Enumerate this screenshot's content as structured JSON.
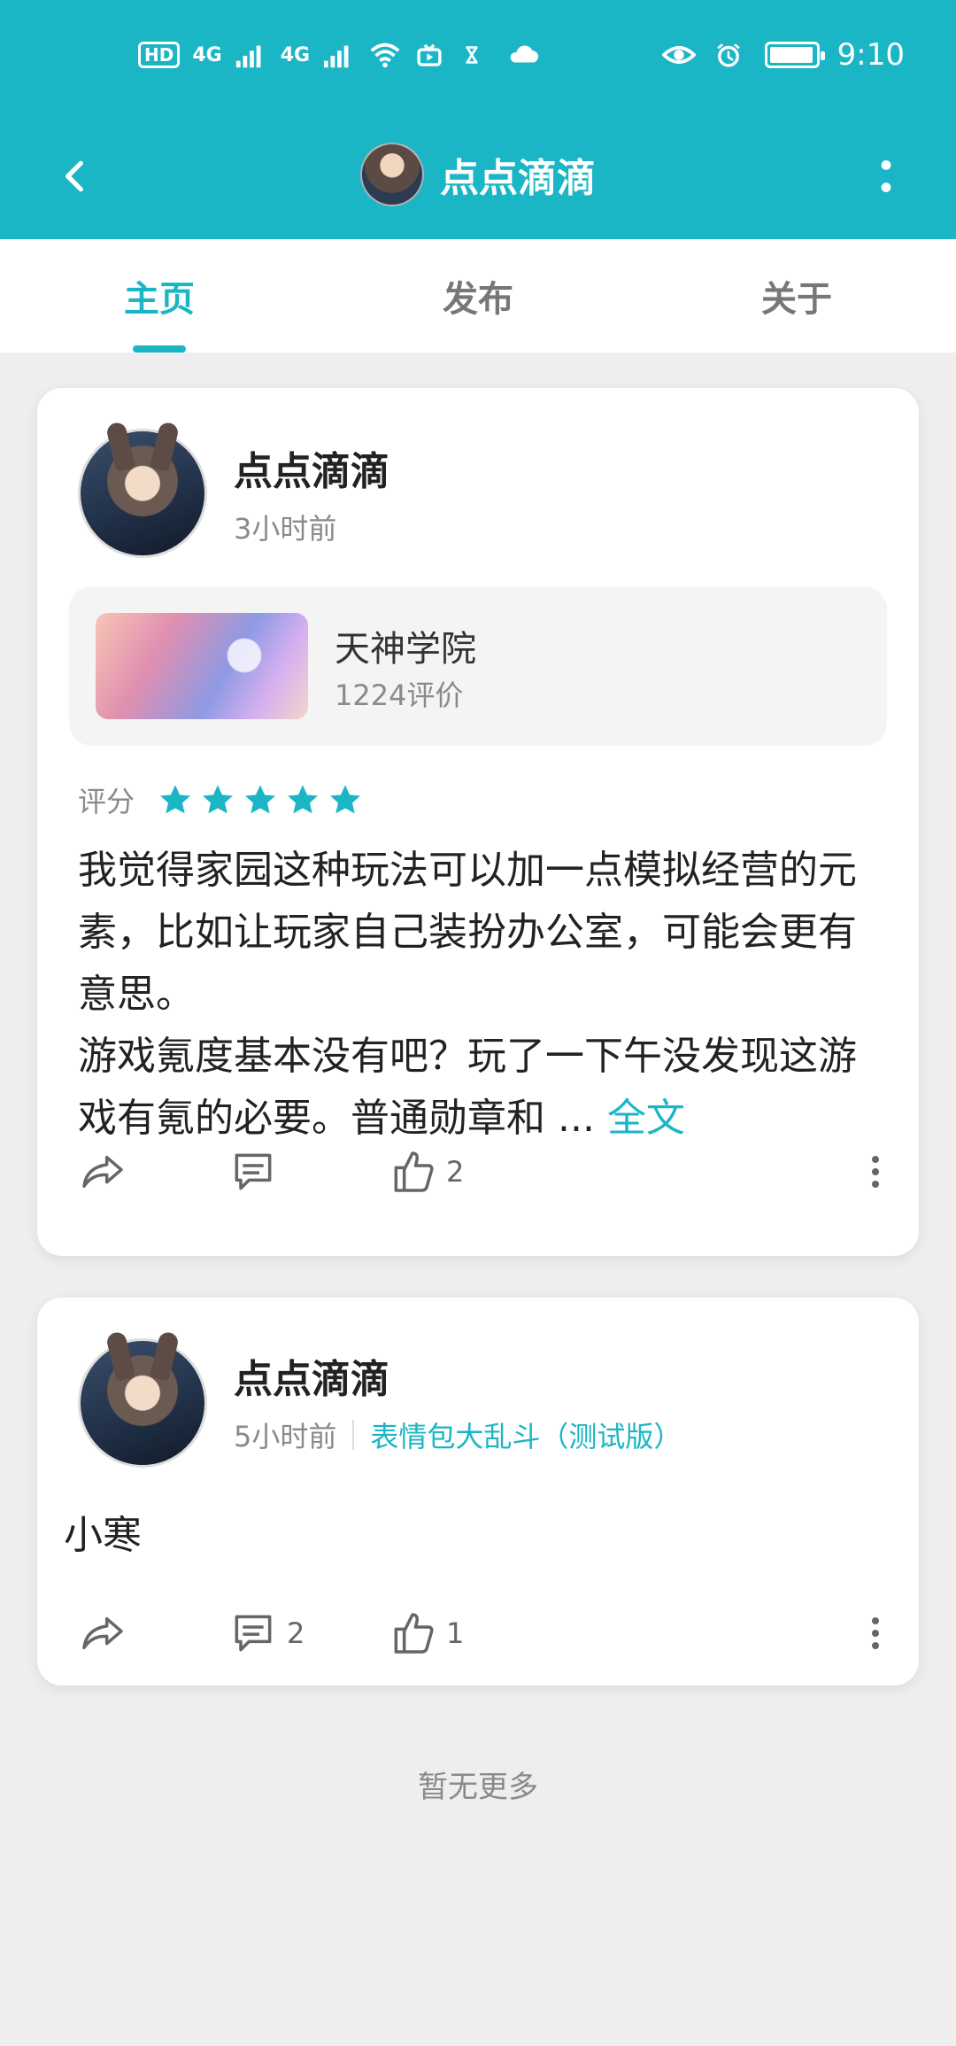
{
  "status_bar": {
    "hd_label": "HD",
    "network_1": "4G",
    "network_2": "4G",
    "time": "9:10",
    "icons": [
      "hd-icon",
      "signal-icon",
      "signal-icon",
      "wifi-icon",
      "tv-icon",
      "hourglass-icon",
      "cloud-icon",
      "eye-icon",
      "alarm-icon",
      "battery-icon"
    ]
  },
  "header": {
    "title": "点点滴滴"
  },
  "tabs": [
    {
      "label": "主页",
      "active": true
    },
    {
      "label": "发布",
      "active": false
    },
    {
      "label": "关于",
      "active": false
    }
  ],
  "posts": [
    {
      "author": "点点滴滴",
      "time": "3小时前",
      "game": {
        "title": "天神学院",
        "reviews": "1224评价"
      },
      "rating_label": "评分",
      "rating": 5,
      "text_lines": [
        "我觉得家园这种玩法可以加一点模拟经营的元素，比如让玩家自己装扮办公室，可能会更有意思。",
        "游戏氪度基本没有吧？玩了一下午没发现这游戏有氪的必要。普通勋章和 ... "
      ],
      "full_text_link": "全文",
      "actions": {
        "comments": "",
        "likes": "2"
      }
    },
    {
      "author": "点点滴滴",
      "time": "5小时前",
      "game_link": "表情包大乱斗（测试版）",
      "text": "小寒",
      "actions": {
        "comments": "2",
        "likes": "1"
      }
    }
  ],
  "footer": {
    "no_more": "暂无更多"
  },
  "colors": {
    "primary": "#1bb6c5",
    "background": "#eeeeee",
    "card": "#ffffff"
  }
}
